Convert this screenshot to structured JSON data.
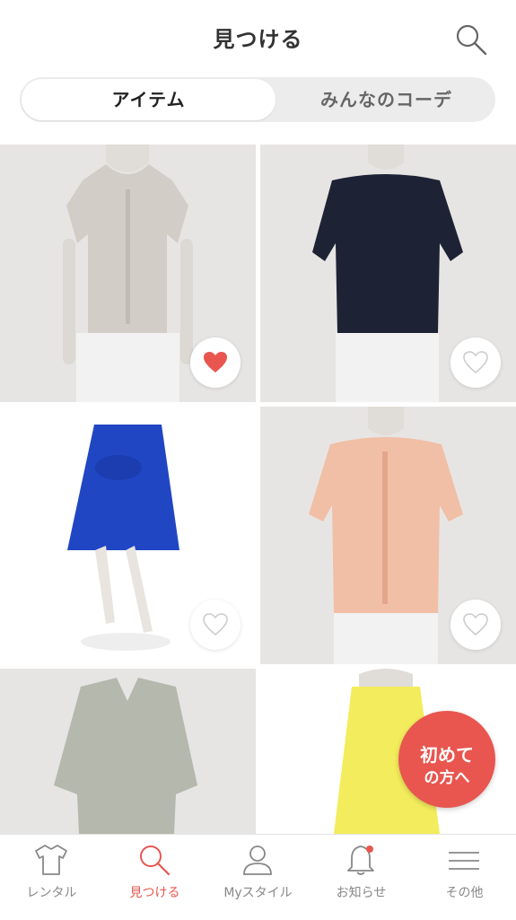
{
  "header": {
    "title": "見つける",
    "search_icon": "search-icon"
  },
  "segment": {
    "tabs": [
      {
        "label": "アイテム",
        "active": true
      },
      {
        "label": "みんなのコーデ",
        "active": false
      }
    ]
  },
  "items": [
    {
      "name": "ruffle-sleeve-blouse-grey",
      "color": "#d3cdc8",
      "favorited": true
    },
    {
      "name": "flutter-sleeve-top-navy",
      "color": "#1e2235",
      "favorited": false
    },
    {
      "name": "bow-flare-skirt-blue",
      "color": "#2046c4",
      "favorited": false
    },
    {
      "name": "puff-sleeve-blouse-peach",
      "color": "#f1bfa6",
      "favorited": false
    },
    {
      "name": "vneck-knit-top-sage",
      "color": "#b4b8ad",
      "favorited": false
    },
    {
      "name": "pleated-skirt-yellow",
      "color": "#f3ec5c",
      "favorited": false
    }
  ],
  "first_time_button": {
    "line1": "初めて",
    "line2": "の方へ",
    "color": "#e8564f"
  },
  "tabbar": {
    "items": [
      {
        "label": "レンタル",
        "icon": "shirt-icon",
        "active": false
      },
      {
        "label": "見つける",
        "icon": "search-icon",
        "active": true
      },
      {
        "label": "Myスタイル",
        "icon": "person-icon",
        "active": false
      },
      {
        "label": "お知らせ",
        "icon": "bell-icon",
        "active": false,
        "badge": true
      },
      {
        "label": "その他",
        "icon": "menu-icon",
        "active": false
      }
    ]
  },
  "colors": {
    "accent": "#e8564f",
    "heart_active": "#e8564f",
    "heart_inactive": "#cccccc"
  }
}
